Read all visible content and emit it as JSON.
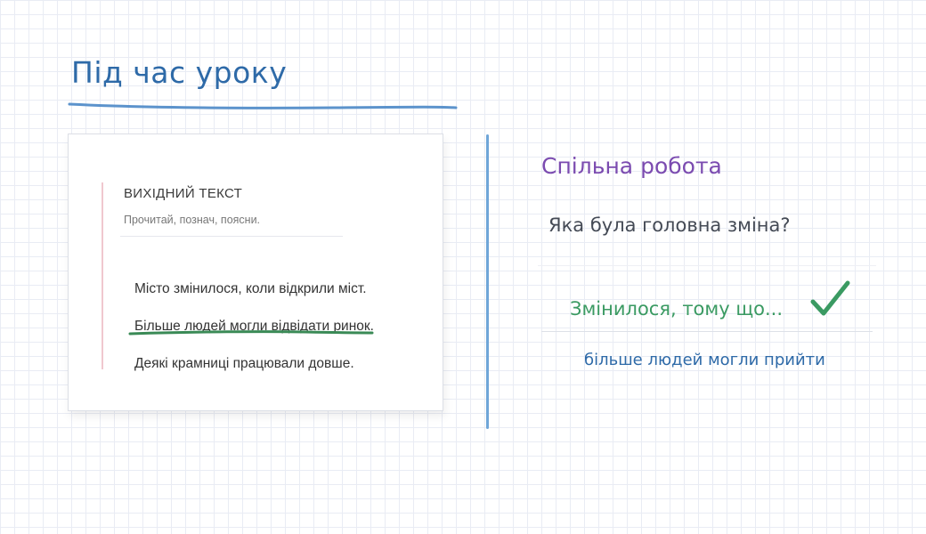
{
  "header": {
    "title": "Під час уроку"
  },
  "source_card": {
    "heading": "ВИХІДНИЙ ТЕКСТ",
    "subtitle": "Прочитай, познач, поясни.",
    "lines": [
      "Місто змінилося, коли відкрили міст.",
      "Більше людей могли відвідати ринок.",
      "Деякі крамниці працювали довше."
    ]
  },
  "collab": {
    "title": "Спільна робота",
    "question": "Яка була головна зміна?",
    "sentence_starter": "Змінилося, тому що...",
    "answer": "більше людей могли прийти"
  },
  "colors": {
    "title": "#2e6aa8",
    "section_title": "#7b4bb0",
    "starter": "#3a9a62",
    "answer": "#2e6aa8",
    "divider": "#6fa6d8",
    "underline": "#3a8a56",
    "check": "#3a9a62"
  },
  "icons": {
    "check": "check-icon"
  }
}
